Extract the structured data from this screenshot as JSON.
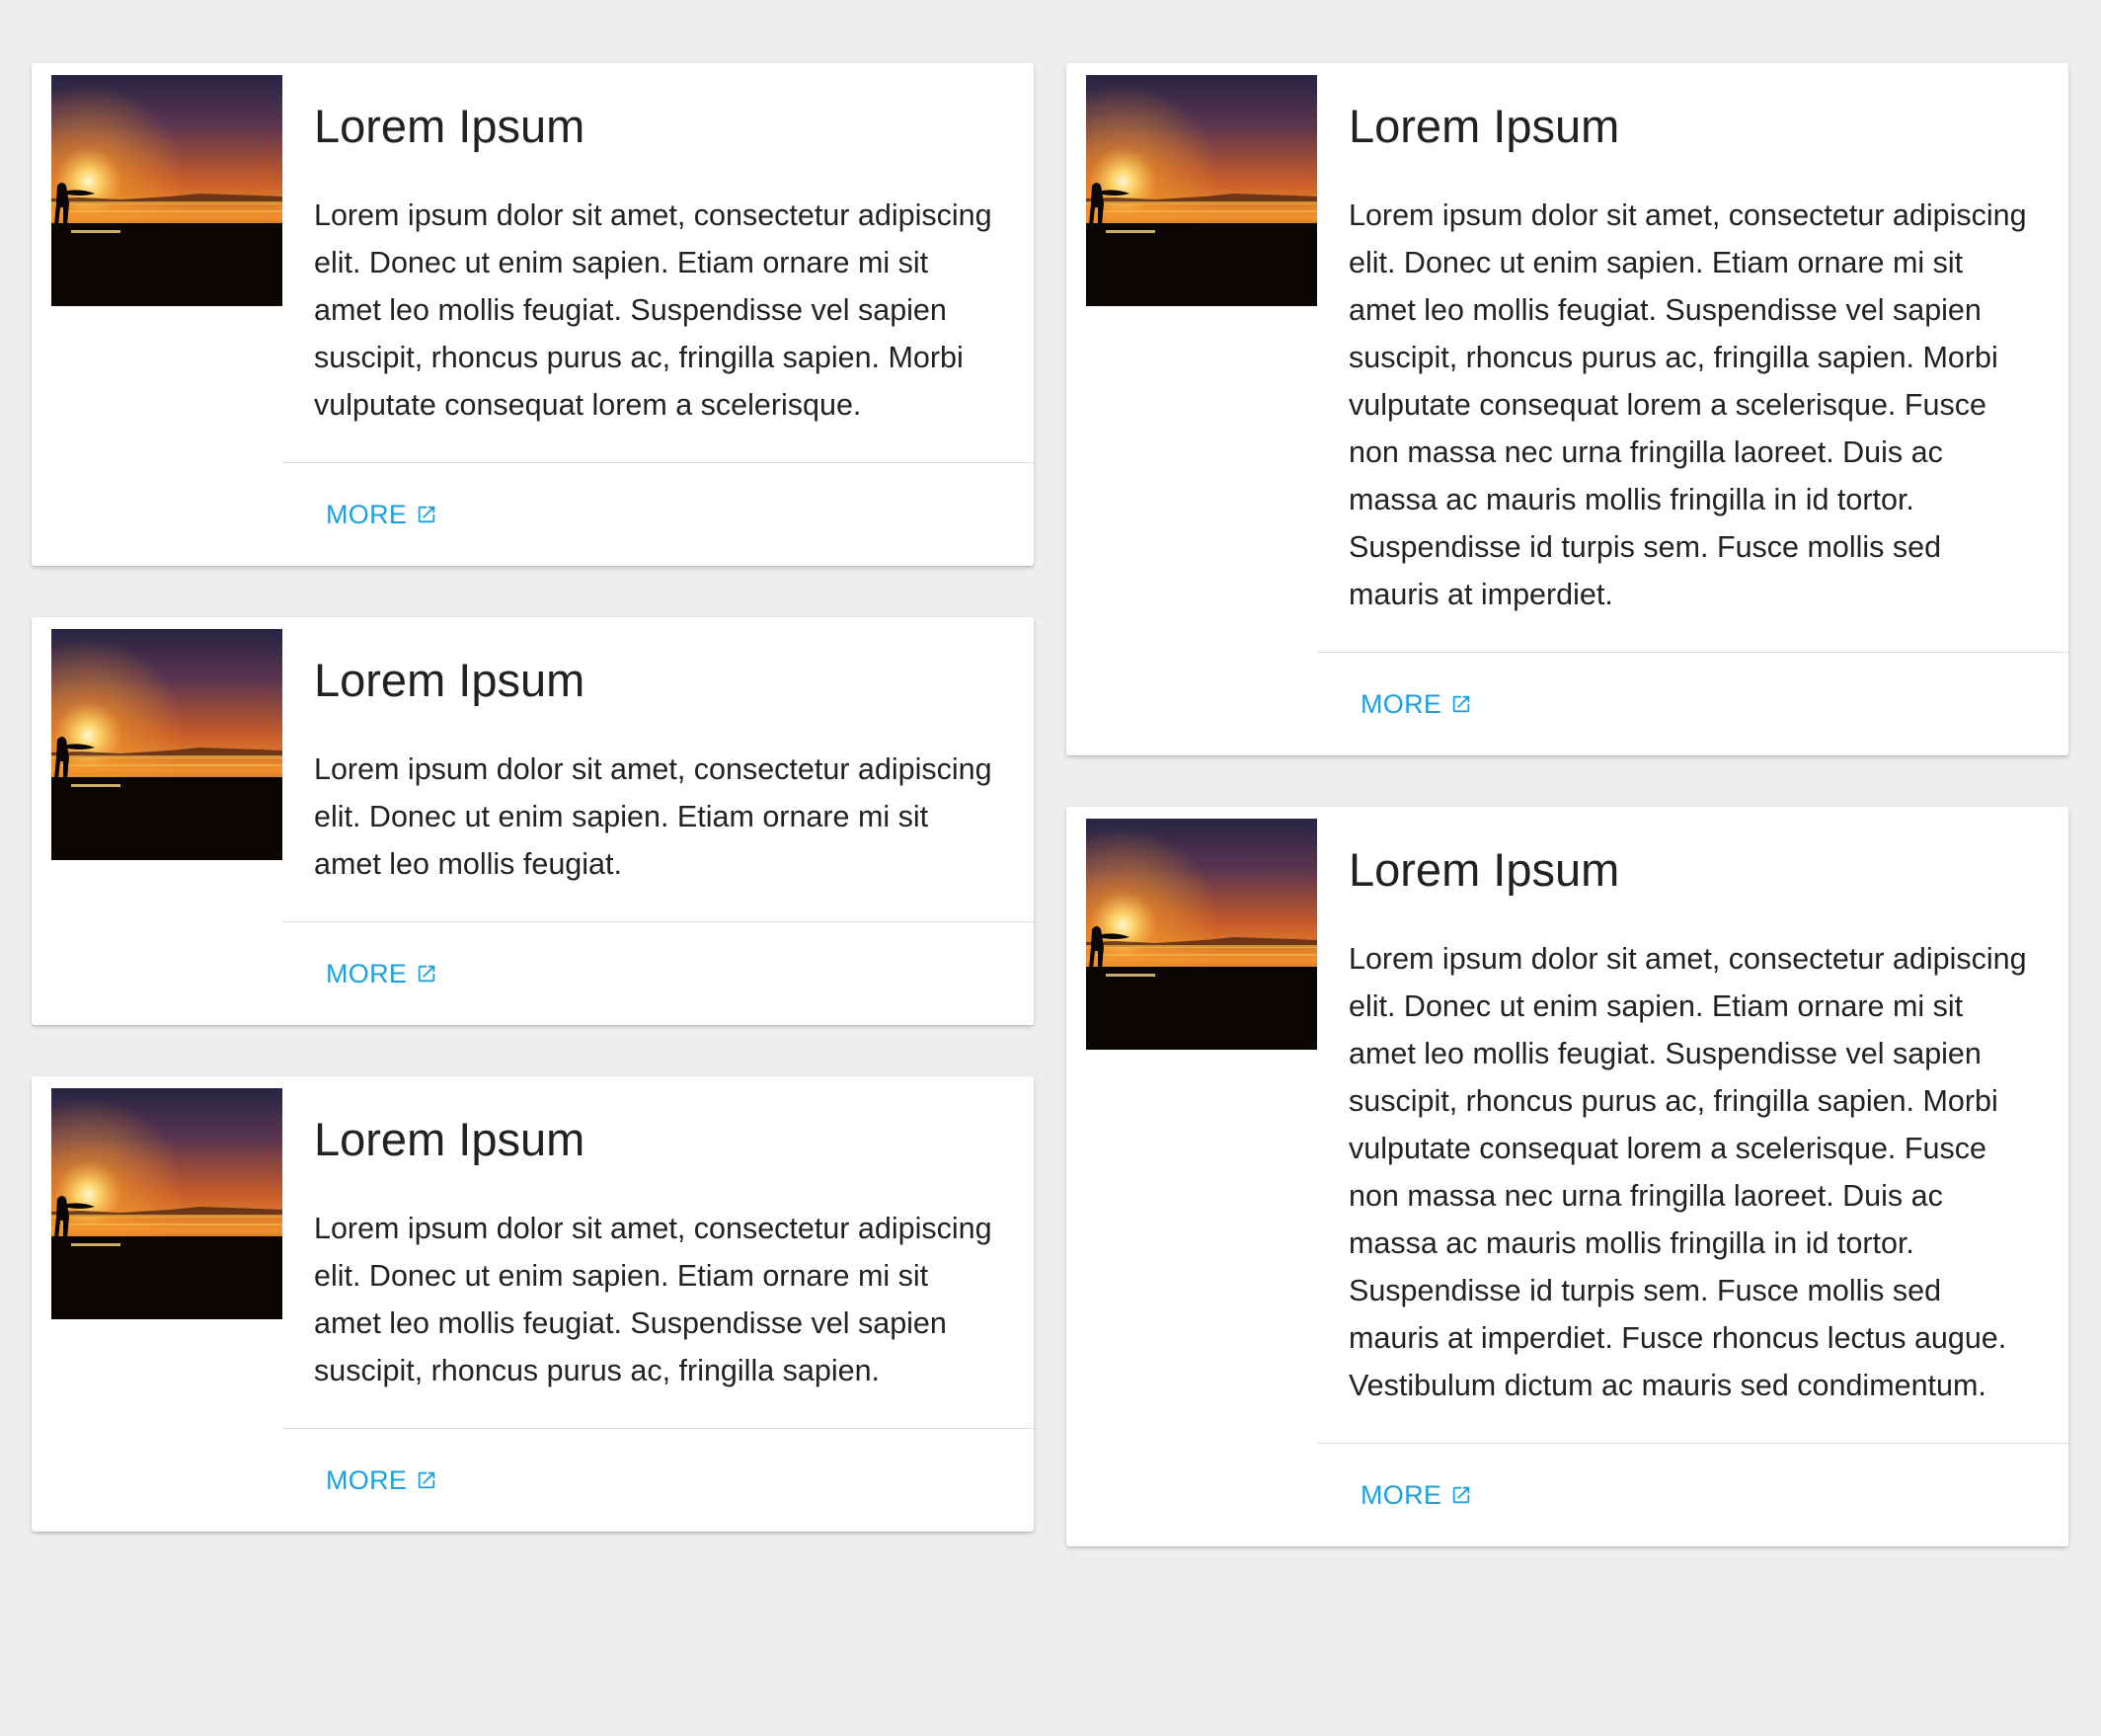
{
  "colors": {
    "background": "#eeeeee",
    "card": "#ffffff",
    "link": "#1ba0e2",
    "title": "#212121",
    "text": "#222222"
  },
  "card_image": {
    "icon": "sunset-surfer-photo"
  },
  "cards": [
    {
      "title": "Lorem Ipsum",
      "text": "Lorem ipsum dolor sit amet, consectetur adipiscing elit. Donec ut enim sapien. Etiam ornare mi sit amet leo mollis feugiat. Suspendisse vel sapien suscipit, rhoncus purus ac, fringilla sapien. Morbi vulputate consequat lorem a scelerisque.",
      "more_label": "MORE",
      "more_icon": "external-link-icon"
    },
    {
      "title": "Lorem Ipsum",
      "text": "Lorem ipsum dolor sit amet, consectetur adipiscing elit. Donec ut enim sapien. Etiam ornare mi sit amet leo mollis feugiat.",
      "more_label": "MORE",
      "more_icon": "external-link-icon"
    },
    {
      "title": "Lorem Ipsum",
      "text": "Lorem ipsum dolor sit amet, consectetur adipiscing elit. Donec ut enim sapien. Etiam ornare mi sit amet leo mollis feugiat. Suspendisse vel sapien suscipit, rhoncus purus ac, fringilla sapien.",
      "more_label": "MORE",
      "more_icon": "external-link-icon"
    },
    {
      "title": "Lorem Ipsum",
      "text": "Lorem ipsum dolor sit amet, consectetur adipiscing elit. Donec ut enim sapien. Etiam ornare mi sit amet leo mollis feugiat. Suspendisse vel sapien suscipit, rhoncus purus ac, fringilla sapien. Morbi vulputate consequat lorem a scelerisque. Fusce non massa nec urna fringilla laoreet. Duis ac massa ac mauris mollis fringilla in id tortor. Suspendisse id turpis sem. Fusce mollis sed mauris at imperdiet.",
      "more_label": "MORE",
      "more_icon": "external-link-icon"
    },
    {
      "title": "Lorem Ipsum",
      "text": "Lorem ipsum dolor sit amet, consectetur adipiscing elit. Donec ut enim sapien. Etiam ornare mi sit amet leo mollis feugiat. Suspendisse vel sapien suscipit, rhoncus purus ac, fringilla sapien. Morbi vulputate consequat lorem a scelerisque. Fusce non massa nec urna fringilla laoreet. Duis ac massa ac mauris mollis fringilla in id tortor. Suspendisse id turpis sem. Fusce mollis sed mauris at imperdiet. Fusce rhoncus lectus augue. Vestibulum dictum ac mauris sed condimentum.",
      "more_label": "MORE",
      "more_icon": "external-link-icon"
    }
  ]
}
